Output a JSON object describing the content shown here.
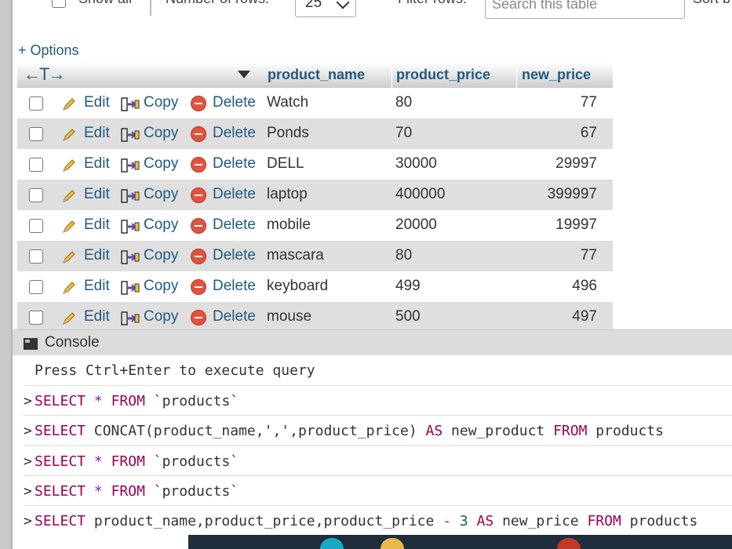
{
  "top": {
    "show_all_label": "Show all",
    "rows_label": "Number of rows:",
    "rows_value": "25",
    "filter_label": "Filter rows:",
    "filter_placeholder": "Search this table",
    "sort_label": "Sort b"
  },
  "options_label": "+ Options",
  "table": {
    "headers": [
      "product_name",
      "product_price",
      "new_price"
    ],
    "action_labels": {
      "edit": "Edit",
      "copy": "Copy",
      "delete": "Delete"
    },
    "rows": [
      {
        "product_name": "Watch",
        "product_price": "80",
        "new_price": "77"
      },
      {
        "product_name": "Ponds",
        "product_price": "70",
        "new_price": "67"
      },
      {
        "product_name": "DELL",
        "product_price": "30000",
        "new_price": "29997"
      },
      {
        "product_name": "laptop",
        "product_price": "400000",
        "new_price": "399997"
      },
      {
        "product_name": "mobile",
        "product_price": "20000",
        "new_price": "19997"
      },
      {
        "product_name": "mascara",
        "product_price": "80",
        "new_price": "77"
      },
      {
        "product_name": "keyboard",
        "product_price": "499",
        "new_price": "496"
      },
      {
        "product_name": "mouse",
        "product_price": "500",
        "new_price": "497"
      }
    ]
  },
  "console": {
    "title": "Console",
    "hint": "Press Ctrl+Enter to execute query",
    "prompt": ">",
    "queries": [
      "SELECT * FROM `products`",
      "SELECT CONCAT(product_name,',',product_price) AS new_product FROM products",
      "SELECT * FROM `products`",
      "SELECT * FROM `products`",
      "SELECT product_name,product_price,product_price - 3 AS new_price FROM products"
    ]
  },
  "colors": {
    "link": "#235a81",
    "keyword": "#990055",
    "delete_icon": "#e0533f"
  },
  "icons": [
    "pencil-icon",
    "copy-icon",
    "delete-icon",
    "console-icon",
    "sort-arrow-icon"
  ]
}
